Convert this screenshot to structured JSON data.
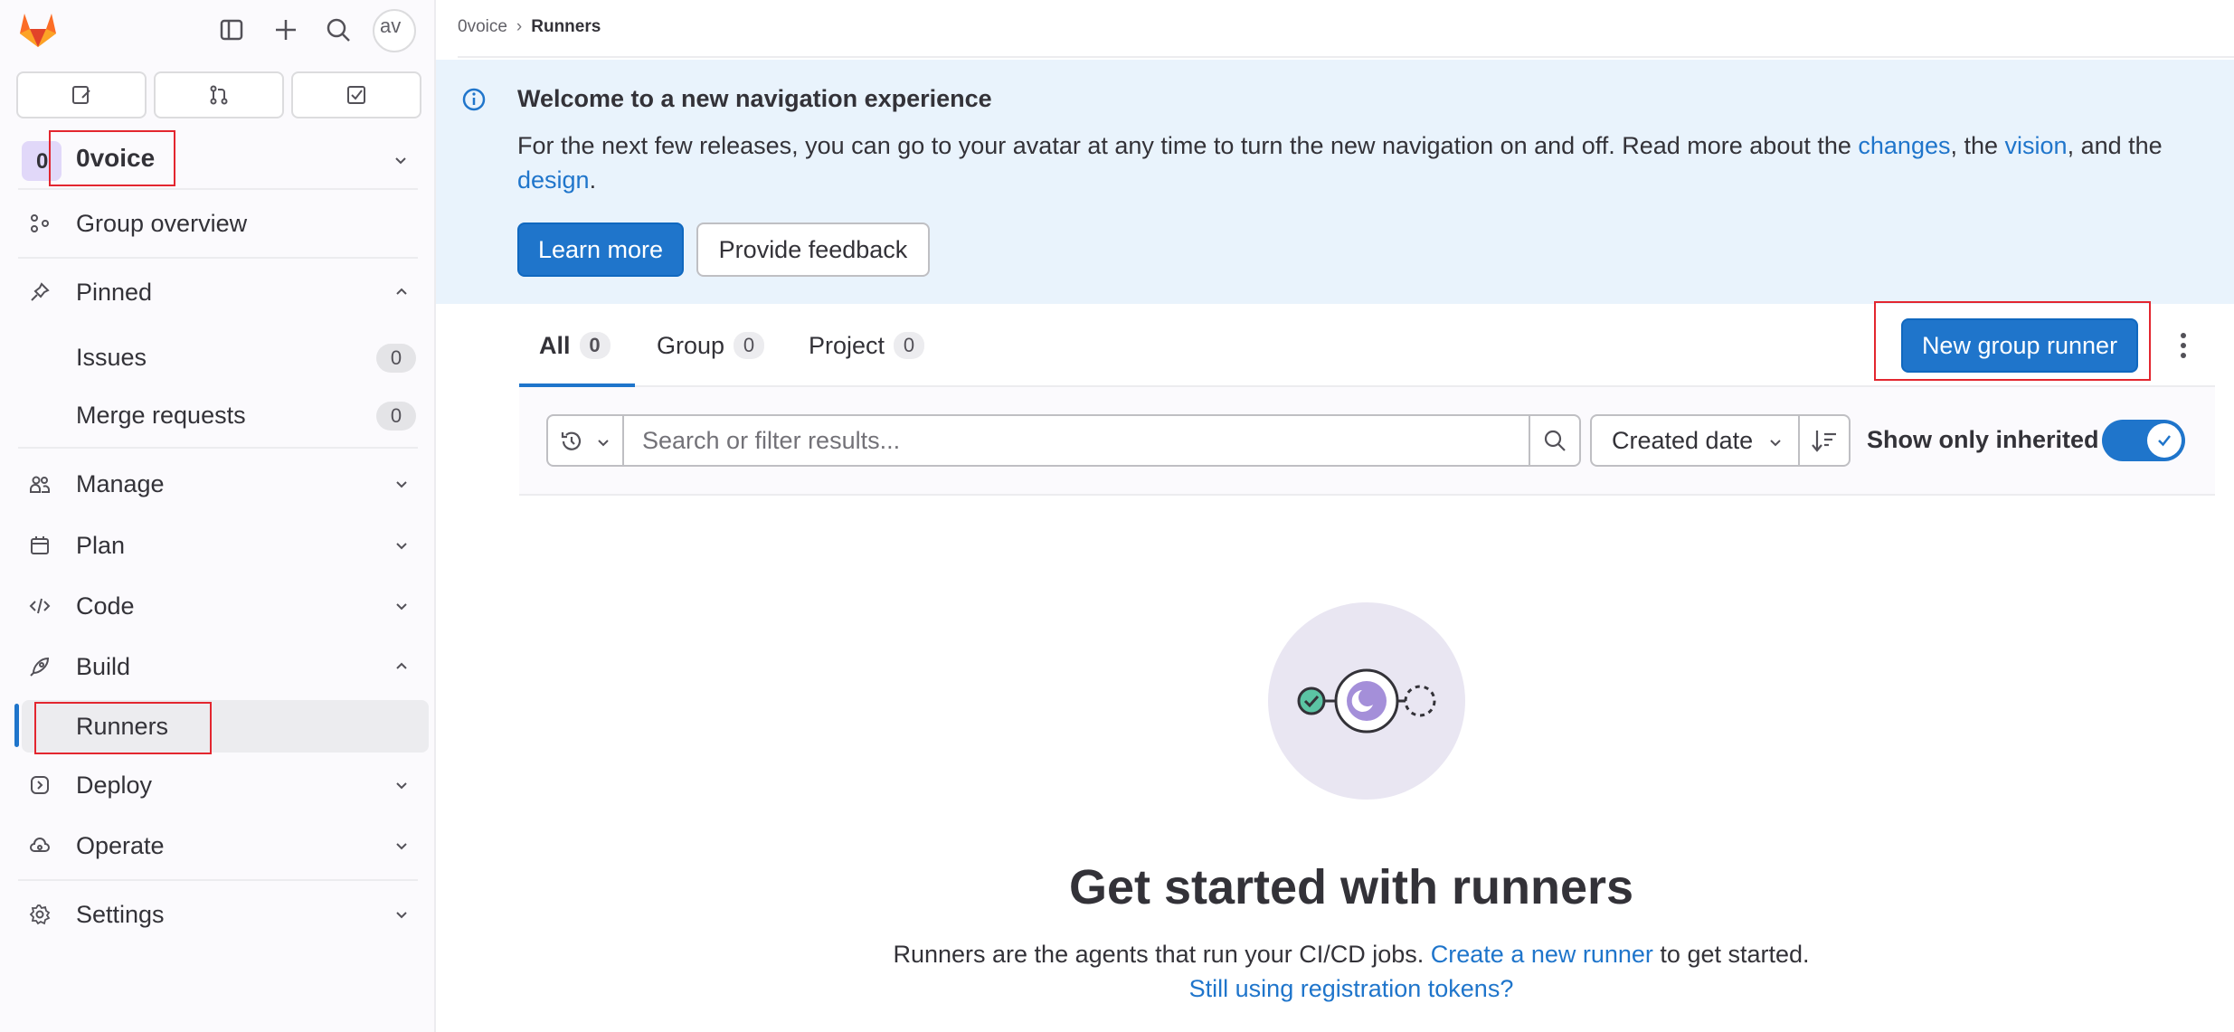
{
  "sidebar": {
    "avatar_alt": "av",
    "group": {
      "avatar_letter": "0",
      "name": "0voice"
    },
    "group_overview": "Group overview",
    "pinned": {
      "label": "Pinned",
      "items": [
        {
          "label": "Issues",
          "count": "0"
        },
        {
          "label": "Merge requests",
          "count": "0"
        }
      ]
    },
    "sections": {
      "manage": "Manage",
      "plan": "Plan",
      "code": "Code",
      "build": "Build",
      "runners": "Runners",
      "deploy": "Deploy",
      "operate": "Operate",
      "settings": "Settings"
    }
  },
  "breadcrumb": {
    "group": "0voice",
    "current": "Runners"
  },
  "banner": {
    "title": "Welcome to a new navigation experience",
    "text_before": "For the next few releases, you can go to your avatar at any time to turn the new navigation on and off. Read more about the ",
    "link_changes": "changes",
    "text_mid1": ", the ",
    "link_vision": "vision",
    "text_mid2": ", and the ",
    "link_design": "design",
    "text_end": ".",
    "learn_more": "Learn more",
    "provide_feedback": "Provide feedback"
  },
  "tabs": [
    {
      "label": "All",
      "count": "0"
    },
    {
      "label": "Group",
      "count": "0"
    },
    {
      "label": "Project",
      "count": "0"
    }
  ],
  "new_runner_button": "New group runner",
  "filter": {
    "search_placeholder": "Search or filter results...",
    "sort_label": "Created date",
    "toggle_label": "Show only inherited",
    "toggle_on": true
  },
  "empty_state": {
    "title": "Get started with runners",
    "desc_before": "Runners are the agents that run your CI/CD jobs. ",
    "desc_link": "Create a new runner",
    "desc_after": " to get started.",
    "link2": "Still using registration tokens?"
  },
  "colors": {
    "accent": "#1f75cb",
    "highlight_box": "#e3262f",
    "banner_bg": "#e9f3fc"
  }
}
